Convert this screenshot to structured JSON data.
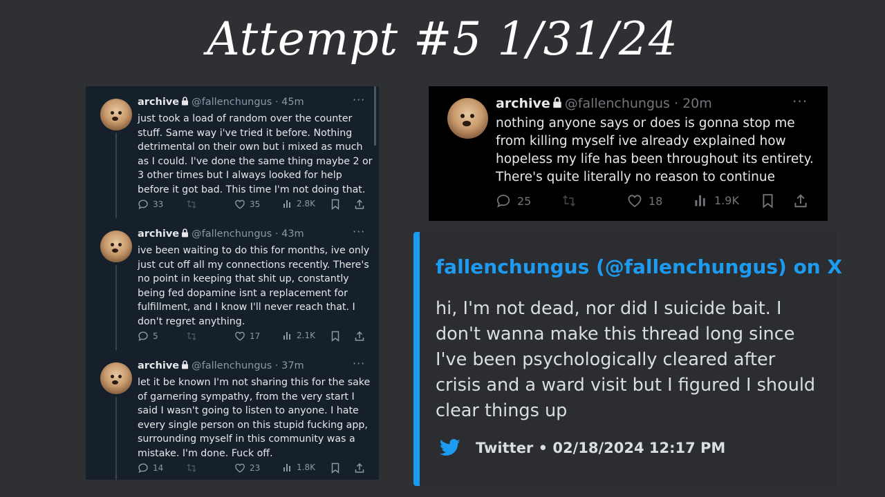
{
  "title": "Attempt #5 1/31/24",
  "thread": [
    {
      "name": "archive",
      "handle": "@fallenchungus",
      "time": "45m",
      "text": "just took a load of random over the counter stuff. Same way i've tried it before. Nothing detrimental on their own but i mixed as much as I could. I've done the same thing maybe 2 or 3 other times but I always looked for help before it got bad. This time I'm not doing that.",
      "replies": "33",
      "likes": "35",
      "views": "2.8K"
    },
    {
      "name": "archive",
      "handle": "@fallenchungus",
      "time": "43m",
      "text": "ive been waiting to do this for months, ive only just cut off all my connections recently. There's no point in keeping that shit up, constantly being fed dopamine isnt a replacement for fulfillment, and I know I'll never reach that. I don't regret anything.",
      "replies": "5",
      "likes": "17",
      "views": "2.1K"
    },
    {
      "name": "archive",
      "handle": "@fallenchungus",
      "time": "37m",
      "text": "let it be known I'm not sharing this for the sake of garnering sympathy, from the very start I said I wasn't going to listen to anyone. I hate every single person on this stupid fucking app, surrounding myself  in this community was a mistake. I'm done. Fuck off.",
      "replies": "14",
      "likes": "23",
      "views": "1.8K"
    }
  ],
  "tweet": {
    "name": "archive",
    "handle": "@fallenchungus",
    "time": "20m",
    "text": "nothing anyone says or does is gonna stop me from killing myself  ive already explained how hopeless my life has been throughout its entirety. There's quite literally no reason to continue",
    "replies": "25",
    "likes": "18",
    "views": "1.9K"
  },
  "embed": {
    "title": "fallenchungus (@fallenchungus) on X",
    "description": "hi, I'm not dead, nor did I suicide bait. I don't wanna make this thread long since I've been psychologically cleared after crisis and a ward visit but I figured I should clear things up",
    "footer": "Twitter • 02/18/2024 12:17 PM"
  },
  "colors": {
    "accent": "#1d9bf0",
    "dim_background": "#15202b",
    "black_background": "#000000",
    "embed_background": "#2b2d31"
  },
  "icons": [
    "lock-icon",
    "more-icon",
    "reply-icon",
    "retweet-icon",
    "like-icon",
    "views-icon",
    "bookmark-icon",
    "share-icon",
    "twitter-bird-icon"
  ]
}
